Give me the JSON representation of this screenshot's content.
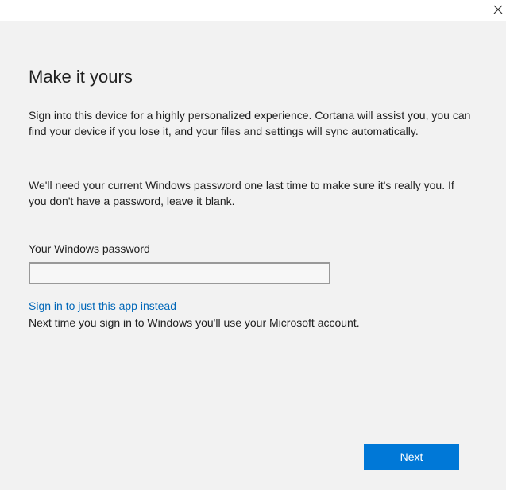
{
  "titlebar": {
    "close_icon": "close-icon"
  },
  "main": {
    "title": "Make it yours",
    "paragraph1": "Sign into this device for a highly personalized experience. Cortana will assist you, you can find your device if you lose it, and your files and settings will sync automatically.",
    "paragraph2": "We'll need your current Windows password one last time to make sure it's really you. If you don't have a password, leave it blank.",
    "password_label": "Your Windows password",
    "password_value": "",
    "alt_link": "Sign in to just this app instead",
    "alt_hint": "Next time you sign in to Windows you'll use your Microsoft account."
  },
  "footer": {
    "next_label": "Next"
  },
  "colors": {
    "accent": "#0078d7",
    "link": "#0067b8",
    "panel_bg": "#f2f2f2"
  }
}
